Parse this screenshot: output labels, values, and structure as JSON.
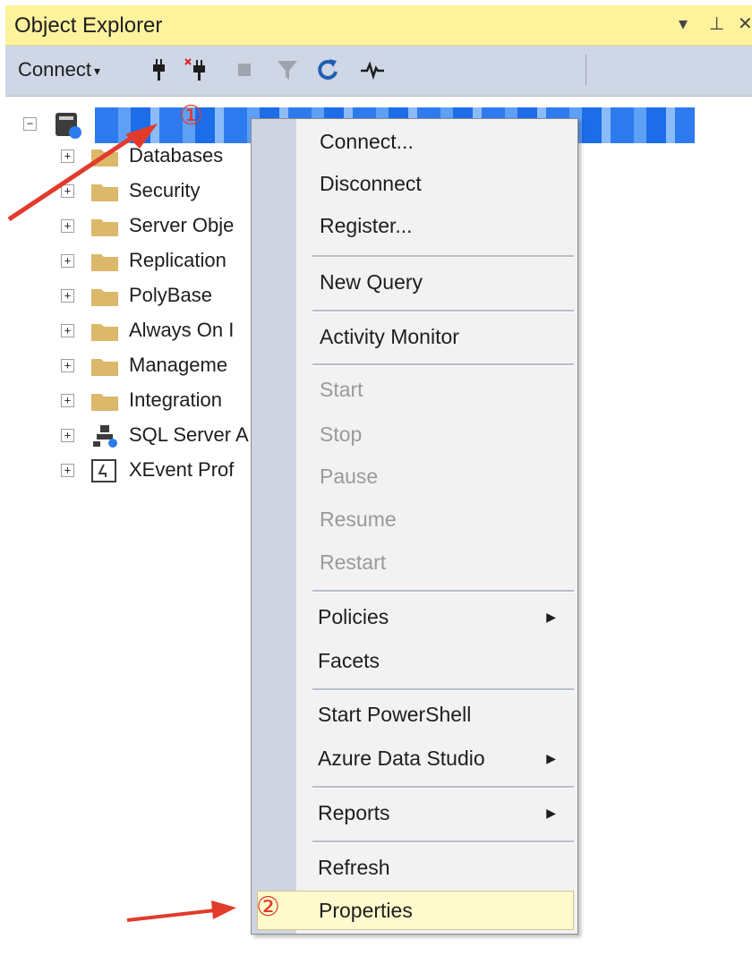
{
  "window": {
    "title": "Object Explorer",
    "pin_glyph": "▾ ⊥ ✕"
  },
  "toolbar": {
    "connect_label": "Connect",
    "caret": "▾"
  },
  "tree": {
    "server_expander": "−",
    "children_expander": "+",
    "items": [
      {
        "label": "Databases",
        "icon": "folder-icon"
      },
      {
        "label": "Security",
        "icon": "folder-icon"
      },
      {
        "label": "Server Obje",
        "icon": "folder-icon"
      },
      {
        "label": "Replication",
        "icon": "folder-icon"
      },
      {
        "label": "PolyBase",
        "icon": "folder-icon"
      },
      {
        "label": "Always On I",
        "icon": "folder-icon"
      },
      {
        "label": "Manageme",
        "icon": "folder-icon"
      },
      {
        "label": "Integration",
        "icon": "folder-icon"
      },
      {
        "label": "SQL Server A",
        "icon": "sql-agent-icon"
      },
      {
        "label": "XEvent Prof",
        "icon": "xevent-profiler-icon"
      }
    ]
  },
  "menu": {
    "items": [
      {
        "label": "Connect...",
        "enabled": true
      },
      {
        "label": "Disconnect",
        "enabled": true
      },
      {
        "label": "Register...",
        "enabled": true
      },
      {
        "label": "New Query",
        "enabled": true
      },
      {
        "label": "Activity Monitor",
        "enabled": true
      },
      {
        "label": "Start",
        "enabled": false
      },
      {
        "label": "Stop",
        "enabled": false
      },
      {
        "label": "Pause",
        "enabled": false
      },
      {
        "label": "Resume",
        "enabled": false
      },
      {
        "label": "Restart",
        "enabled": false
      },
      {
        "label": "Policies",
        "enabled": true,
        "submenu": true
      },
      {
        "label": "Facets",
        "enabled": true
      },
      {
        "label": "Start PowerShell",
        "enabled": true
      },
      {
        "label": "Azure Data Studio",
        "enabled": true,
        "submenu": true
      },
      {
        "label": "Reports",
        "enabled": true,
        "submenu": true
      },
      {
        "label": "Refresh",
        "enabled": true
      },
      {
        "label": "Properties",
        "enabled": true,
        "highlighted": true
      }
    ],
    "submenu_arrow": "▶"
  },
  "annotations": {
    "step1": "①",
    "step2": "②",
    "color": "#e23a2b"
  },
  "colors": {
    "title_bar": "#fff29d",
    "toolbar": "#cfd6e5",
    "selection": "#2d7bef",
    "highlight": "#fffacd"
  }
}
